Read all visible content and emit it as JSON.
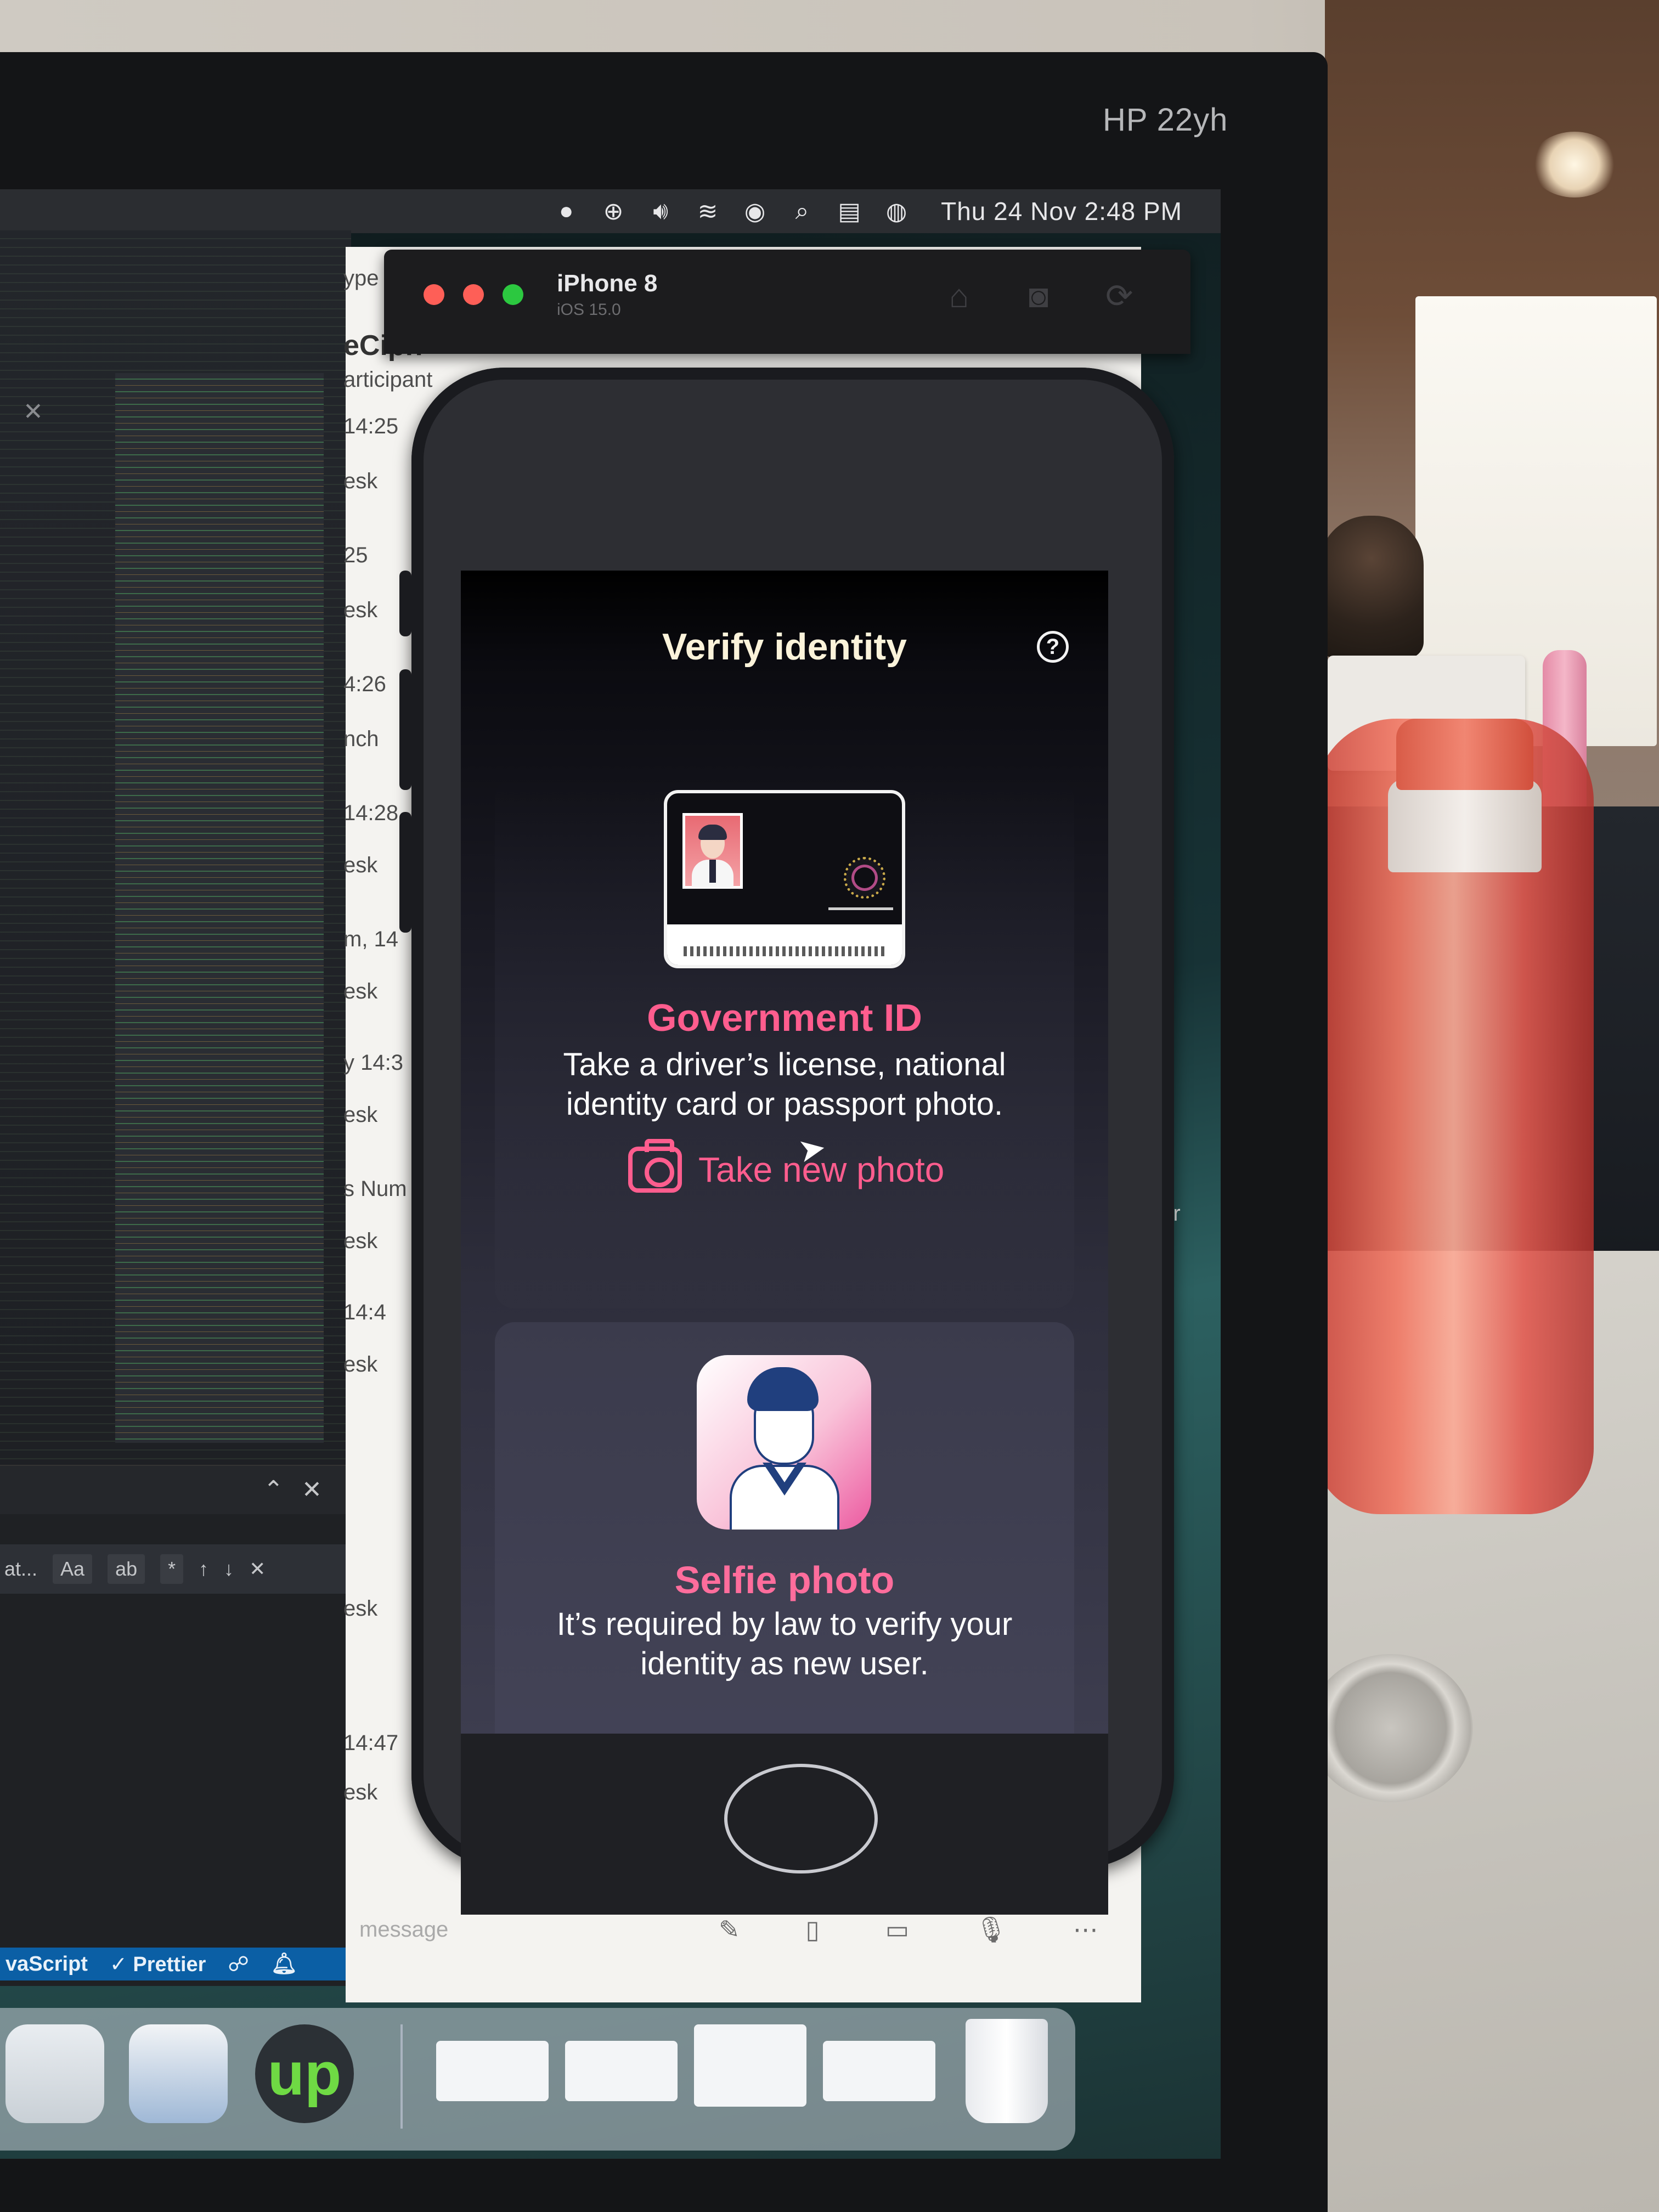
{
  "monitor": {
    "brand": "HP 22yh"
  },
  "menubar": {
    "clock": "Thu 24 Nov  2:48 PM",
    "icons": [
      "skype-icon",
      "accessibility-icon",
      "volume-icon",
      "wifi-icon",
      "vpn-icon",
      "search-icon",
      "control-center-icon",
      "user-icon"
    ]
  },
  "simulator": {
    "title": "iPhone 8",
    "subtitle": "iOS 15.0"
  },
  "app": {
    "title": "Verify identity",
    "help_icon": "?",
    "government": {
      "title": "Government ID",
      "description": "Take a driver’s license, national identity card or passport photo.",
      "action": "Take new photo"
    },
    "selfie": {
      "title": "Selfie photo",
      "description": "It’s required by law to verify your identity as new user."
    }
  },
  "chat": {
    "peek_labels": [
      "ype",
      "eCiph",
      "articipant",
      "14:25",
      "esk",
      "25",
      "esk",
      "4:26",
      "nch",
      "14:28",
      "esk",
      "m, 14",
      "esk",
      "y 14:3",
      "esk",
      "s Num",
      "esk",
      "14:4",
      "esk",
      "esk",
      "14:47",
      "esk",
      "ter"
    ],
    "input_placeholder": "message"
  },
  "vscode": {
    "find_label": "at...",
    "find_options": [
      "Aa",
      "ab",
      "*"
    ],
    "status": [
      "vaScript",
      "✓ Prettier"
    ]
  },
  "dock": {
    "upwork_logo": "up"
  },
  "colors": {
    "accent_pink": "#ff5d8e",
    "screen_bg": "#1c1c26",
    "title": "#fbf3da"
  }
}
